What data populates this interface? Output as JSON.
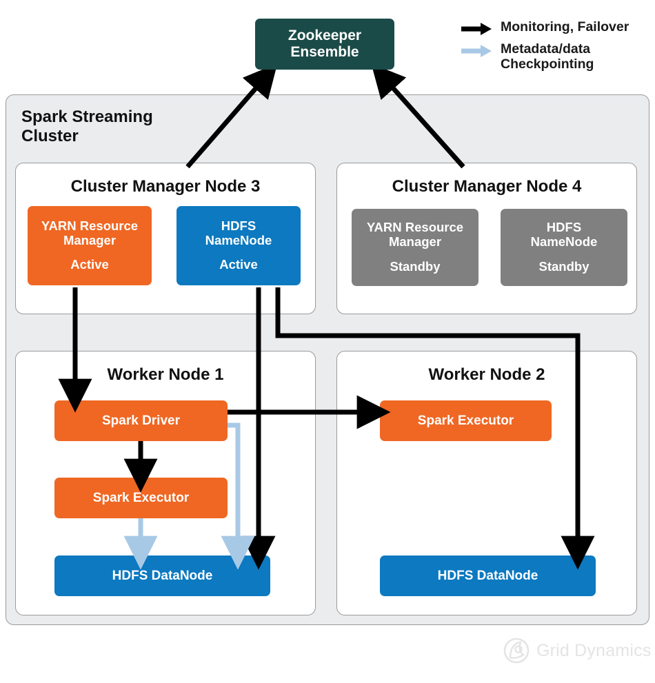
{
  "zookeeper": {
    "label": "Zookeeper\nEnsemble",
    "color": "#1b4b48"
  },
  "legend": {
    "items": [
      {
        "icon": "black-arrow-icon",
        "label": "Monitoring, Failover",
        "color": "#000000"
      },
      {
        "icon": "blue-arrow-icon",
        "label": "Metadata/data\nCheckpointing",
        "color": "#a8c9e6"
      }
    ]
  },
  "cluster": {
    "title": "Spark Streaming\nCluster",
    "background": "#eaecee"
  },
  "nodes": [
    {
      "id": "cluster-manager-node-3",
      "title": "Cluster Manager Node 3",
      "services": [
        {
          "name": "YARN Resource\nManager",
          "state": "Active",
          "color": "#ef6723",
          "style": "orange"
        },
        {
          "name": "HDFS\nNameNode",
          "state": "Active",
          "color": "#0c79c0",
          "style": "blue"
        }
      ]
    },
    {
      "id": "cluster-manager-node-4",
      "title": "Cluster Manager Node 4",
      "services": [
        {
          "name": "YARN Resource\nManager",
          "state": "Standby",
          "color": "#808080",
          "style": "gray"
        },
        {
          "name": "HDFS\nNameNode",
          "state": "Standby",
          "color": "#808080",
          "style": "gray"
        }
      ]
    },
    {
      "id": "worker-node-1",
      "title": "Worker Node 1",
      "services": [
        {
          "name": "Spark Driver",
          "state": "",
          "color": "#ef6723",
          "style": "orange"
        },
        {
          "name": "Spark Executor",
          "state": "",
          "color": "#ef6723",
          "style": "orange"
        },
        {
          "name": "HDFS DataNode",
          "state": "",
          "color": "#0c79c0",
          "style": "blue"
        }
      ]
    },
    {
      "id": "worker-node-2",
      "title": "Worker Node 2",
      "services": [
        {
          "name": "Spark Executor",
          "state": "",
          "color": "#ef6723",
          "style": "orange"
        },
        {
          "name": "HDFS DataNode",
          "state": "",
          "color": "#0c79c0",
          "style": "blue"
        }
      ]
    }
  ],
  "watermark": {
    "text": "Grid Dynamics",
    "color": "#e4e4e4"
  }
}
